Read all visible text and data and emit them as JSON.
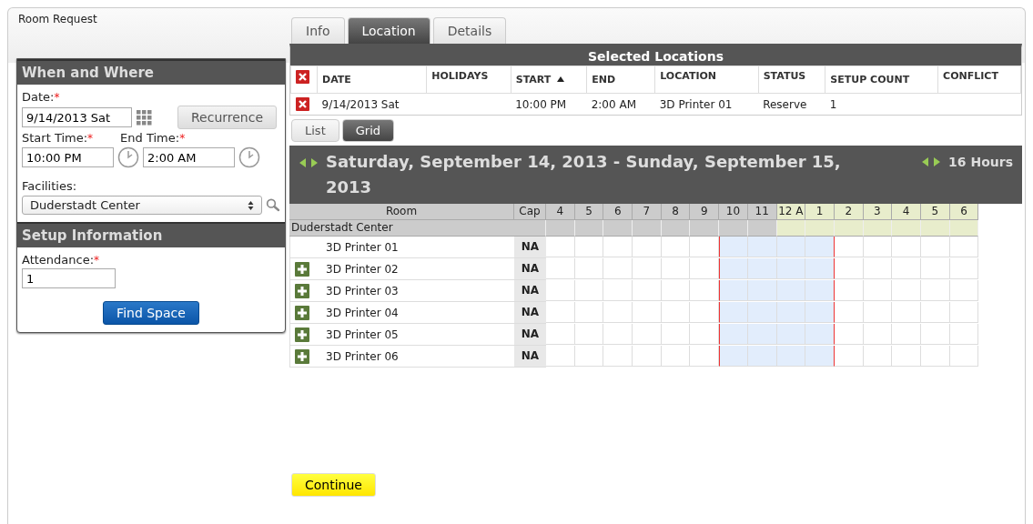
{
  "page_title": "Room Request",
  "when_where": {
    "title": "When and Where",
    "date": {
      "label": "Date:",
      "required_mark": "*",
      "value": "9/14/2013 Sat"
    },
    "recurrence_button": "Recurrence",
    "start_time": {
      "label": "Start Time:",
      "required_mark": "*",
      "value": "10:00 PM"
    },
    "end_time": {
      "label": "End Time:",
      "required_mark": "*",
      "value": "2:00 AM"
    },
    "facilities": {
      "label": "Facilities:",
      "value": "Duderstadt Center"
    }
  },
  "setup": {
    "title": "Setup Information",
    "attendance": {
      "label": "Attendance:",
      "required_mark": "*",
      "value": "1"
    },
    "find_button": "Find Space"
  },
  "tabs": [
    {
      "label": "Info",
      "selected": false
    },
    {
      "label": "Location",
      "selected": true
    },
    {
      "label": "Details",
      "selected": false
    }
  ],
  "selected_locations": {
    "title": "Selected Locations",
    "columns": [
      {
        "label": "DATE",
        "sorted": false
      },
      {
        "label": "HOLIDAYS",
        "sorted": false
      },
      {
        "label": "START",
        "sorted": true
      },
      {
        "label": "END",
        "sorted": false
      },
      {
        "label": "LOCATION",
        "sorted": false
      },
      {
        "label": "STATUS",
        "sorted": false
      },
      {
        "label": "SETUP COUNT",
        "sorted": false
      },
      {
        "label": "CONFLICT",
        "sorted": false
      }
    ],
    "rows": [
      {
        "cells": [
          "9/14/2013 Sat",
          "",
          "10:00 PM",
          "2:00 AM",
          "3D Printer 01",
          "Reserve",
          "1",
          ""
        ]
      }
    ]
  },
  "view_tabs": [
    {
      "label": "List",
      "selected": false
    },
    {
      "label": "Grid",
      "selected": true
    }
  ],
  "grid": {
    "title": "Saturday, September 14, 2013 - Sunday, September 15, 2013",
    "span": "16 Hours",
    "room_header": "Room",
    "cap_header": "Cap",
    "facility": "Duderstadt Center",
    "hours": [
      {
        "label": "4",
        "next_day": false,
        "selected": false
      },
      {
        "label": "5",
        "next_day": false,
        "selected": false
      },
      {
        "label": "6",
        "next_day": false,
        "selected": false
      },
      {
        "label": "7",
        "next_day": false,
        "selected": false
      },
      {
        "label": "8",
        "next_day": false,
        "selected": false
      },
      {
        "label": "9",
        "next_day": false,
        "selected": false
      },
      {
        "label": "10",
        "next_day": false,
        "selected": true
      },
      {
        "label": "11",
        "next_day": false,
        "selected": true
      },
      {
        "label": "12 A",
        "next_day": true,
        "selected": true
      },
      {
        "label": "1",
        "next_day": true,
        "selected": true
      },
      {
        "label": "2",
        "next_day": true,
        "selected": false
      },
      {
        "label": "3",
        "next_day": true,
        "selected": false
      },
      {
        "label": "4",
        "next_day": true,
        "selected": false
      },
      {
        "label": "5",
        "next_day": true,
        "selected": false
      },
      {
        "label": "6",
        "next_day": true,
        "selected": false
      }
    ],
    "rooms": [
      {
        "name": "3D Printer 01",
        "cap": "NA",
        "addable": false
      },
      {
        "name": "3D Printer 02",
        "cap": "NA",
        "addable": true
      },
      {
        "name": "3D Printer 03",
        "cap": "NA",
        "addable": true
      },
      {
        "name": "3D Printer 04",
        "cap": "NA",
        "addable": true
      },
      {
        "name": "3D Printer 05",
        "cap": "NA",
        "addable": true
      },
      {
        "name": "3D Printer 06",
        "cap": "NA",
        "addable": true
      }
    ]
  },
  "continue_button": "Continue"
}
